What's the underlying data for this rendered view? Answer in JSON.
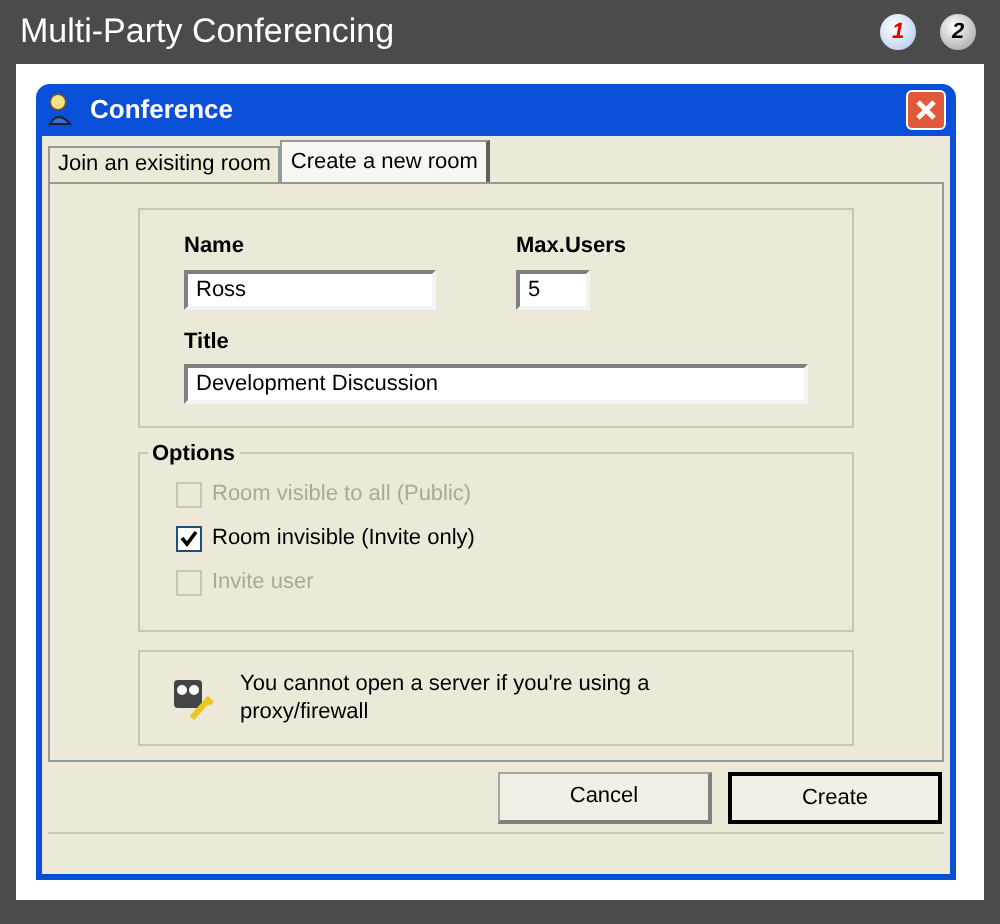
{
  "app": {
    "title": "Multi-Party Conferencing"
  },
  "pages": [
    {
      "label": "1",
      "selected": true
    },
    {
      "label": "2",
      "selected": false
    }
  ],
  "dialog": {
    "title": "Conference"
  },
  "tabs": [
    {
      "label": "Join an exisiting room",
      "selected": false
    },
    {
      "label": "Create a new room",
      "selected": true
    }
  ],
  "form": {
    "name_label": "Name",
    "name_value": "Ross",
    "max_users_label": "Max.Users",
    "max_users_value": "5",
    "title_label": "Title",
    "title_value": "Development Discussion"
  },
  "options": {
    "legend": "Options",
    "items": [
      {
        "label": "Room visible to all (Public)",
        "checked": false,
        "disabled": true
      },
      {
        "label": "Room invisible (Invite only)",
        "checked": true,
        "disabled": false
      },
      {
        "label": "Invite user",
        "checked": false,
        "disabled": true
      }
    ]
  },
  "notice": "You cannot open a server if you're using a proxy/firewall",
  "buttons": [
    {
      "label": "Cancel",
      "default": false
    },
    {
      "label": "Create",
      "default": true
    }
  ]
}
